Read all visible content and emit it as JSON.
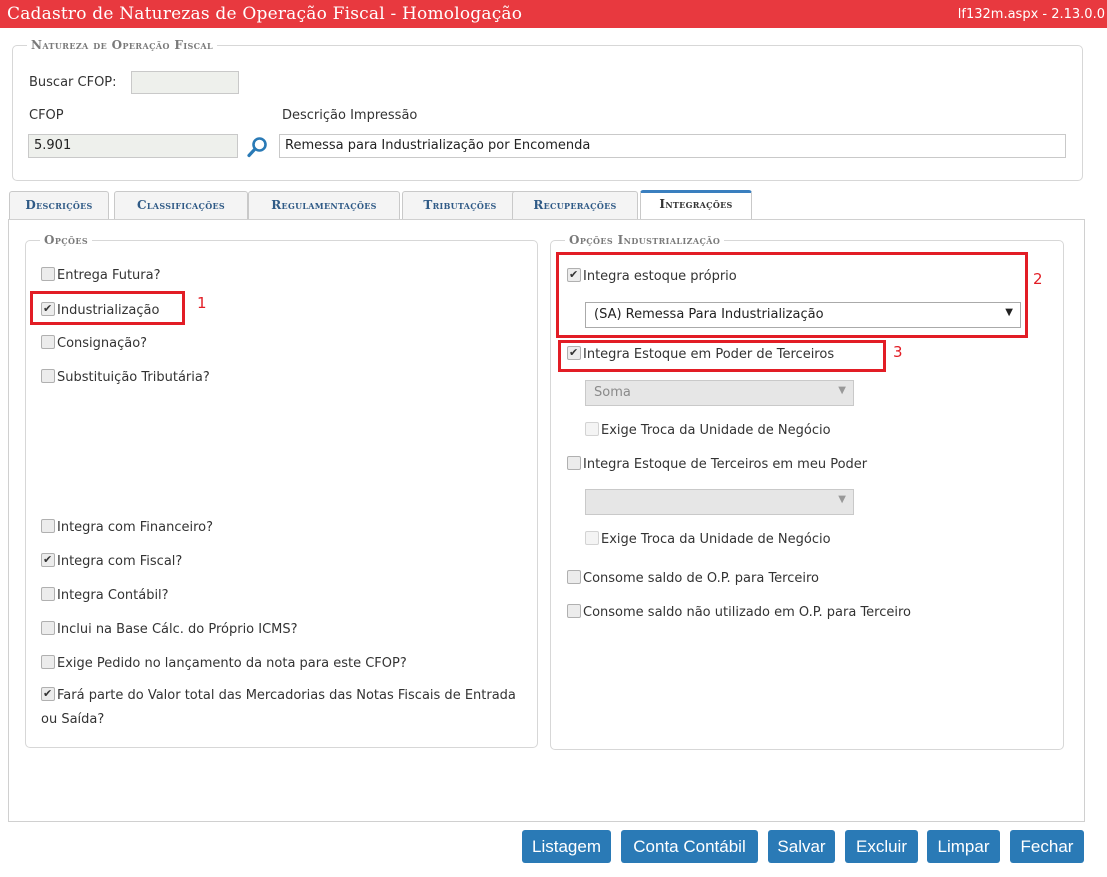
{
  "header": {
    "title": "Cadastro de Naturezas de Operação Fiscal  - Homologação",
    "version": "lf132m.aspx - 2.13.0.0"
  },
  "natureza": {
    "legend": "Natureza de Operação Fiscal",
    "buscar_label": "Buscar CFOP:",
    "buscar_value": "",
    "cfop_label": "CFOP",
    "cfop_value": "5.901",
    "descricao_label": "Descrição Impressão",
    "descricao_value": "Remessa para Industrialização por Encomenda"
  },
  "tabs": [
    {
      "label": "Descrições",
      "active": false
    },
    {
      "label": "Classificações",
      "active": false
    },
    {
      "label": "Regulamentações",
      "active": false
    },
    {
      "label": "Tributações",
      "active": false
    },
    {
      "label": "Recuperações",
      "active": false
    },
    {
      "label": "Integrações",
      "active": true
    }
  ],
  "opcoes": {
    "legend": "Opções",
    "items": [
      {
        "label": "Entrega Futura?",
        "checked": false
      },
      {
        "label": "Industrialização",
        "checked": true
      },
      {
        "label": "Consignação?",
        "checked": false
      },
      {
        "label": "Substituição Tributária?",
        "checked": false
      },
      {
        "label": "Integra com Financeiro?",
        "checked": false
      },
      {
        "label": "Integra com Fiscal?",
        "checked": true
      },
      {
        "label": "Integra Contábil?",
        "checked": false
      },
      {
        "label": "Inclui na Base Cálc. do Próprio ICMS?",
        "checked": false
      },
      {
        "label": "Exige Pedido no lançamento da nota para este CFOP?",
        "checked": false
      },
      {
        "label": "Fará parte do Valor total das Mercadorias das Notas Fiscais de Entrada ou Saída?",
        "checked": true
      }
    ]
  },
  "industrializacao": {
    "legend": "Opções Industrialização",
    "integra_proprio": {
      "label": "Integra estoque próprio",
      "checked": true
    },
    "proprio_select": "(SA) Remessa Para Industrialização",
    "integra_poder_terceiros": {
      "label": "Integra Estoque em Poder de Terceiros",
      "checked": true
    },
    "poder_terceiros_select": "Soma",
    "exige_troca_1": {
      "label": "Exige Troca da Unidade de Negócio",
      "checked": false
    },
    "integra_terceiros_meu_poder": {
      "label": "Integra Estoque de Terceiros em meu Poder",
      "checked": false
    },
    "terceiros_meu_poder_select": "",
    "exige_troca_2": {
      "label": "Exige Troca da Unidade de Negócio",
      "checked": false
    },
    "consome_saldo": {
      "label": "Consome saldo de O.P. para Terceiro",
      "checked": false
    },
    "consome_nao_utilizado": {
      "label": "Consome saldo não utilizado em O.P. para Terceiro",
      "checked": false
    }
  },
  "annotations": {
    "one": "1",
    "two": "2",
    "three": "3",
    "color": "#e21d25"
  },
  "buttons": {
    "listagem": "Listagem",
    "conta_contabil": "Conta Contábil",
    "salvar": "Salvar",
    "excluir": "Excluir",
    "limpar": "Limpar",
    "fechar": "Fechar"
  },
  "colors": {
    "header_bg": "#e8393f",
    "button_bg": "#2a7ab6",
    "tab_text": "#2f5a86"
  }
}
